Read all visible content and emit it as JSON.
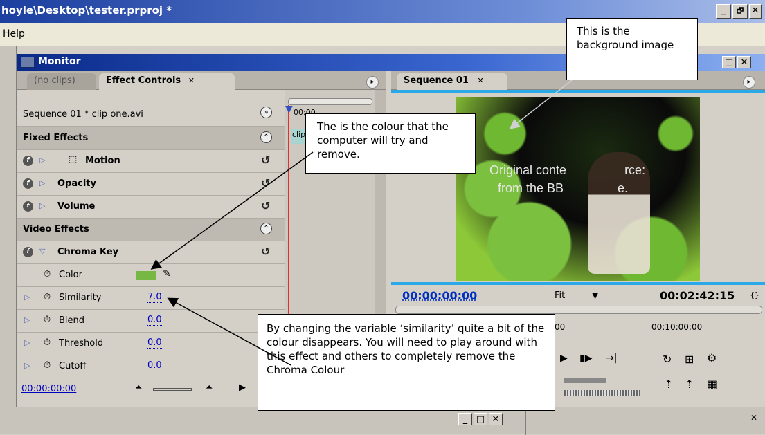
{
  "window": {
    "title": "hoyle\\Desktop\\tester.prproj *",
    "minimize": "_",
    "restore": "🗗",
    "close": "✕"
  },
  "menu": {
    "help": "Help"
  },
  "monitor": {
    "title": "Monitor",
    "left": {
      "tab_inactive": "(no clips)",
      "tab_active": "Effect Controls",
      "tab_close": "✕",
      "clip_label": "Sequence 01 * clip one.avi",
      "timeline_time": "00:00",
      "timeline_clip": "clip",
      "sections": {
        "fixed": "Fixed Effects",
        "video": "Video Effects"
      },
      "effects": [
        {
          "name": "Motion"
        },
        {
          "name": "Opacity"
        },
        {
          "name": "Volume"
        },
        {
          "name": "Chroma Key"
        }
      ],
      "params": [
        {
          "name": "Color",
          "value": ""
        },
        {
          "name": "Similarity",
          "value": "7.0"
        },
        {
          "name": "Blend",
          "value": "0.0"
        },
        {
          "name": "Threshold",
          "value": "0.0"
        },
        {
          "name": "Cutoff",
          "value": "0.0"
        }
      ],
      "current_time": "00:00:00:00",
      "key_color": "#76b843"
    },
    "right": {
      "tab": "Sequence 01",
      "tab_close": "✕",
      "video_text_line1": "Original conte",
      "video_text_line1b": "rce:",
      "video_text_line2": "from the BB",
      "video_text_line2b": "e.",
      "time_current": "00:00:00:00",
      "fit": "Fit",
      "duration": "00:02:42:15",
      "ruler_left": ":00",
      "ruler_right": "00:10:00:00"
    }
  },
  "bottom_panel": {
    "min": "_",
    "max": "□",
    "close": "✕",
    "close2": "✕"
  },
  "annotations": {
    "background": "This is the background image",
    "colour": "The is the colour that the  computer will try and remove.",
    "similarity": "By changing the variable ‘similarity’ quite a bit of the colour disappears. You will need to play around with this effect and others to completely remove the Chroma Colour"
  }
}
